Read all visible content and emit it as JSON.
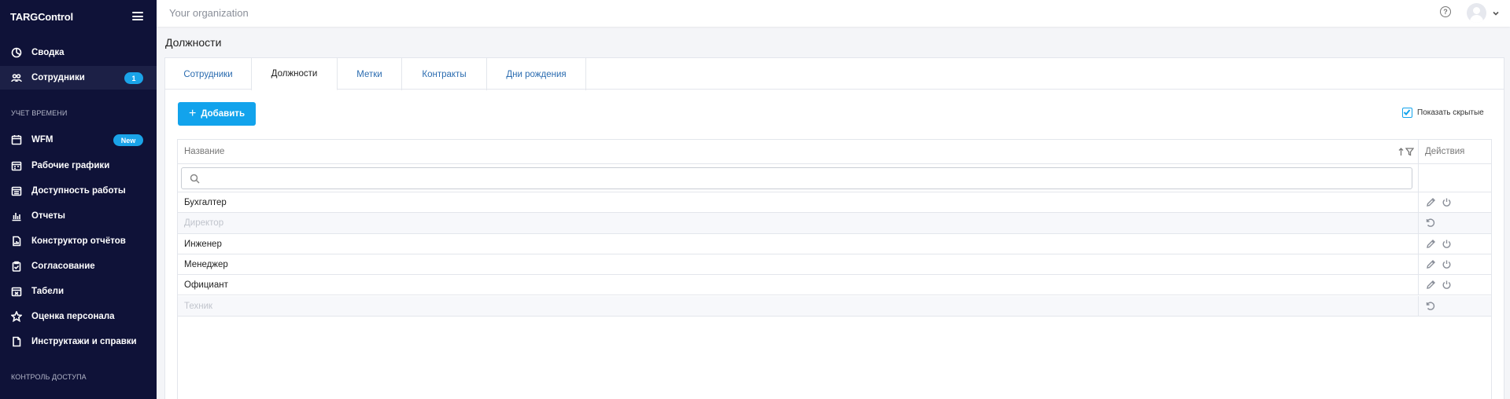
{
  "app": {
    "brand": "TARGControl"
  },
  "sidebar": {
    "items": [
      {
        "label": "Сводка",
        "icon": "dashboard-icon"
      },
      {
        "label": "Сотрудники",
        "icon": "users-icon",
        "badge": "1",
        "active": true
      }
    ],
    "section_time": "УЧЕТ ВРЕМЕНИ",
    "time_items": [
      {
        "label": "WFM",
        "icon": "calendar-icon",
        "badge": "New"
      },
      {
        "label": "Рабочие графики",
        "icon": "schedule-icon"
      },
      {
        "label": "Доступность работы",
        "icon": "availability-icon"
      },
      {
        "label": "Отчеты",
        "icon": "bar-chart-icon"
      },
      {
        "label": "Конструктор отчётов",
        "icon": "report-builder-icon"
      },
      {
        "label": "Согласование",
        "icon": "clipboard-check-icon"
      },
      {
        "label": "Табели",
        "icon": "timesheet-icon"
      },
      {
        "label": "Оценка персонала",
        "icon": "star-icon"
      },
      {
        "label": "Инструктажи и справки",
        "icon": "document-icon"
      }
    ],
    "section_access": "КОНТРОЛЬ ДОСТУПА"
  },
  "topbar": {
    "organization": "Your organization",
    "help": "?"
  },
  "page": {
    "title": "Должности"
  },
  "tabs": [
    {
      "label": "Сотрудники"
    },
    {
      "label": "Должности",
      "active": true
    },
    {
      "label": "Метки"
    },
    {
      "label": "Контракты"
    },
    {
      "label": "Дни рождения"
    }
  ],
  "toolbar": {
    "add_label": "Добавить",
    "show_hidden_label": "Показать скрытые",
    "show_hidden_checked": true
  },
  "table": {
    "columns": {
      "name": "Название",
      "actions": "Действия"
    },
    "search_placeholder": "",
    "rows": [
      {
        "name": "Бухгалтер",
        "hidden": false
      },
      {
        "name": "Директор",
        "hidden": true
      },
      {
        "name": "Инженер",
        "hidden": false
      },
      {
        "name": "Менеджер",
        "hidden": false
      },
      {
        "name": "Официант",
        "hidden": false
      },
      {
        "name": "Техник",
        "hidden": true
      }
    ]
  },
  "colors": {
    "sidebar_bg": "#0f1238",
    "accent": "#12a3ec",
    "link": "#2b6cb0"
  }
}
